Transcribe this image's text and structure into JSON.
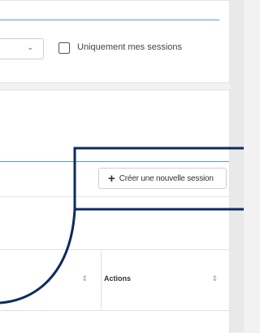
{
  "filters": {
    "select_chevron": "⌄",
    "checkbox_label": "Uniquement mes sessions"
  },
  "sessions": {
    "create_button_label": "Créer une nouvelle session",
    "create_button_icon": "+",
    "table": {
      "columns": [
        {
          "label": "",
          "sortable": true
        },
        {
          "label": "Actions",
          "sortable": true
        }
      ],
      "sort_glyph": "⇕"
    }
  },
  "annotation": {
    "color": "#0d2b5e"
  }
}
